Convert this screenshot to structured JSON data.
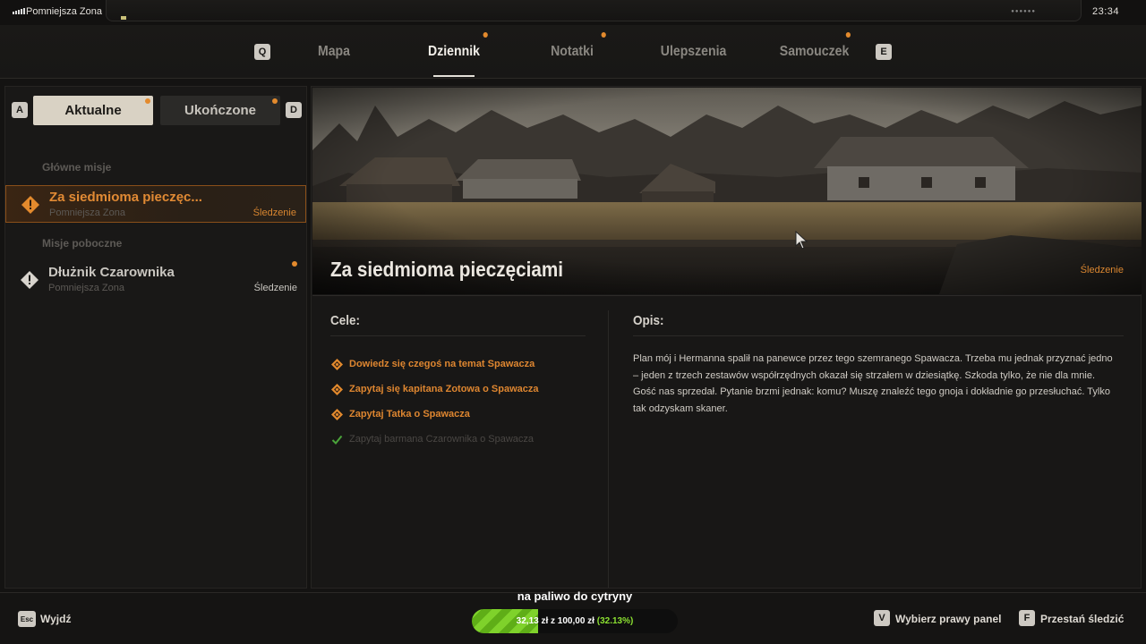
{
  "status_bar": {
    "zone": "Pomniejsza Zona",
    "clock": "23:34"
  },
  "nav": {
    "prev_key": "Q",
    "next_key": "E",
    "tabs": [
      {
        "label": "Mapa",
        "active": false,
        "dot": false
      },
      {
        "label": "Dziennik",
        "active": true,
        "dot": true
      },
      {
        "label": "Notatki",
        "active": false,
        "dot": true
      },
      {
        "label": "Ulepszenia",
        "active": false,
        "dot": false
      },
      {
        "label": "Samouczek",
        "active": false,
        "dot": true
      }
    ]
  },
  "left_panel": {
    "prev_key": "A",
    "next_key": "D",
    "tab_current": "Aktualne",
    "tab_done": "Ukończone",
    "main_section": "Główne misje",
    "side_section": "Misje poboczne",
    "main_quest": {
      "title": "Za siedmioma pieczęc...",
      "zone": "Pomniejsza Zona",
      "tracking": "Śledzenie"
    },
    "side_quest": {
      "title": "Dłużnik Czarownika",
      "zone": "Pomniejsza Zona",
      "tracking": "Śledzenie"
    }
  },
  "detail": {
    "title": "Za siedmioma pieczęciami",
    "tracking": "Śledzenie",
    "objectives_heading": "Cele:",
    "description_heading": "Opis:",
    "objectives": [
      {
        "text": "Dowiedz się czegoś na temat Spawacza",
        "done": false
      },
      {
        "text": "Zapytaj się kapitana Zotowa o Spawacza",
        "done": false
      },
      {
        "text": "Zapytaj Tatka o Spawacza",
        "done": false
      },
      {
        "text": "Zapytaj barmana Czarownika o Spawacza",
        "done": true
      }
    ],
    "description_p1": "Plan mój i Hermanna spalił na panewce przez tego szemranego Spawacza. Trzeba mu jednak przyznać jedno – jeden z trzech zestawów współrzędnych okazał się strzałem w dziesiątkę. Szkoda tylko, że nie dla mnie.",
    "description_p2": "Gość nas sprzedał. Pytanie brzmi jednak: komu? Muszę znaleźć tego gnoja i dokładnie go przesłuchać. Tylko tak odzyskam skaner."
  },
  "bottom_bar": {
    "exit_key": "Esc",
    "exit_label": "Wyjdź",
    "select_key": "V",
    "select_label": "Wybierz prawy panel",
    "track_key": "F",
    "track_label": "Przestań śledzić"
  },
  "donation": {
    "title": "na paliwo do cytryny",
    "amount_text": "32,13 zł z 100,00 zł",
    "percent_text": "(32.13%)",
    "progress": 0.3213
  },
  "colors": {
    "accent": "#e38a2d",
    "progress": "#7fd22b"
  }
}
